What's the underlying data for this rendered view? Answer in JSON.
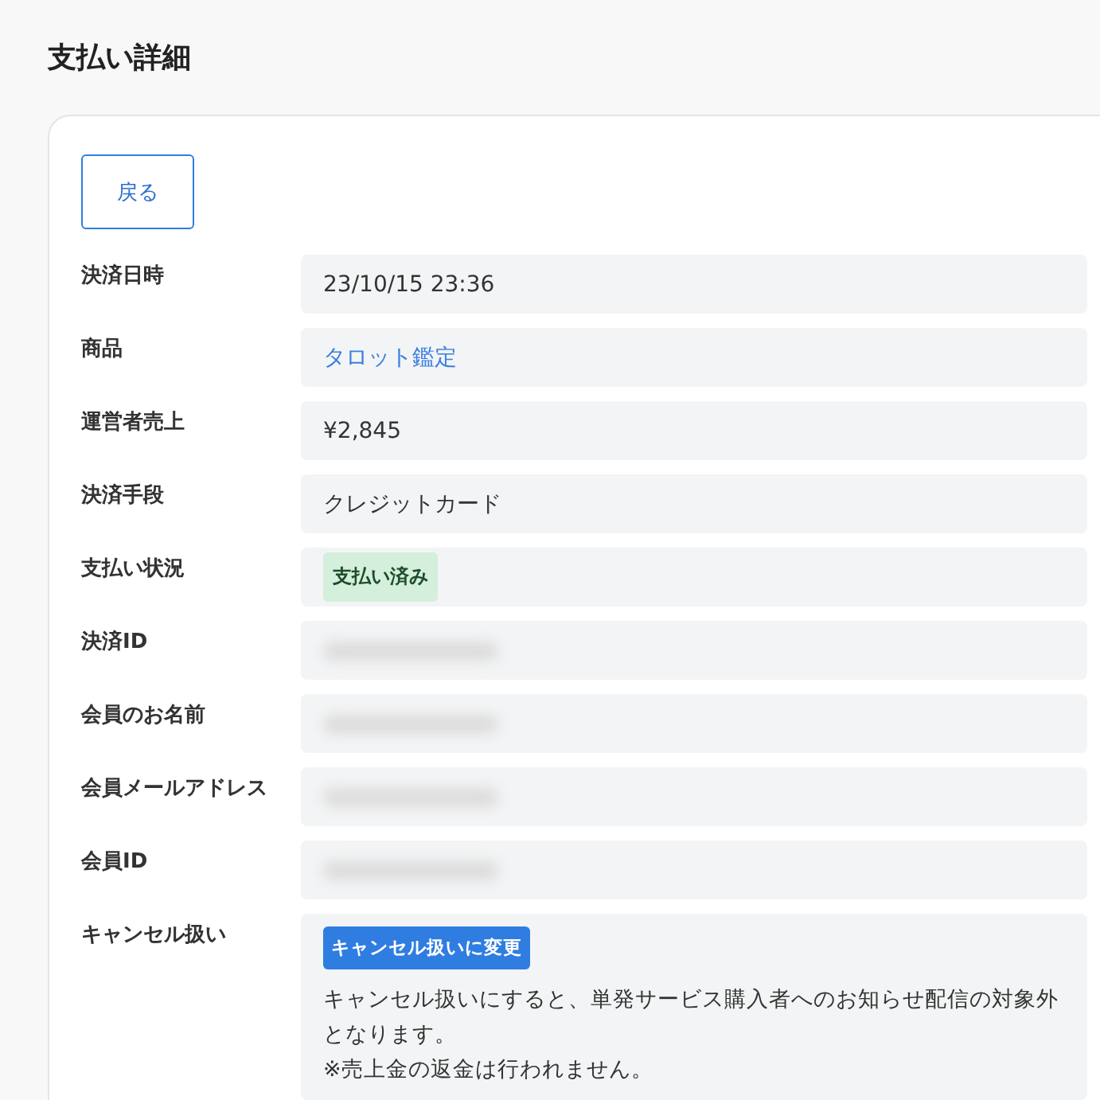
{
  "page_title": "支払い詳細",
  "back_button": "戻る",
  "fields": [
    {
      "label": "決済日時",
      "kind": "text",
      "value": "23/10/15 23:36"
    },
    {
      "label": "商品",
      "kind": "link",
      "value": "タロット鑑定"
    },
    {
      "label": "運営者売上",
      "kind": "text",
      "value": "¥2,845"
    },
    {
      "label": "決済手段",
      "kind": "text",
      "value": "クレジットカード"
    },
    {
      "label": "支払い状況",
      "kind": "badge",
      "value": "支払い済み"
    },
    {
      "label": "決済ID",
      "kind": "redacted"
    },
    {
      "label": "会員のお名前",
      "kind": "redacted"
    },
    {
      "label": "会員メールアドレス",
      "kind": "redacted"
    },
    {
      "label": "会員ID",
      "kind": "redacted"
    },
    {
      "label": "キャンセル扱い",
      "kind": "action",
      "button": "キャンセル扱いに変更",
      "notes": [
        "キャンセル扱いにすると、単発サービス購入者へのお知らせ配信の対象外となります。",
        "※売上金の返金は行われません。"
      ]
    }
  ]
}
